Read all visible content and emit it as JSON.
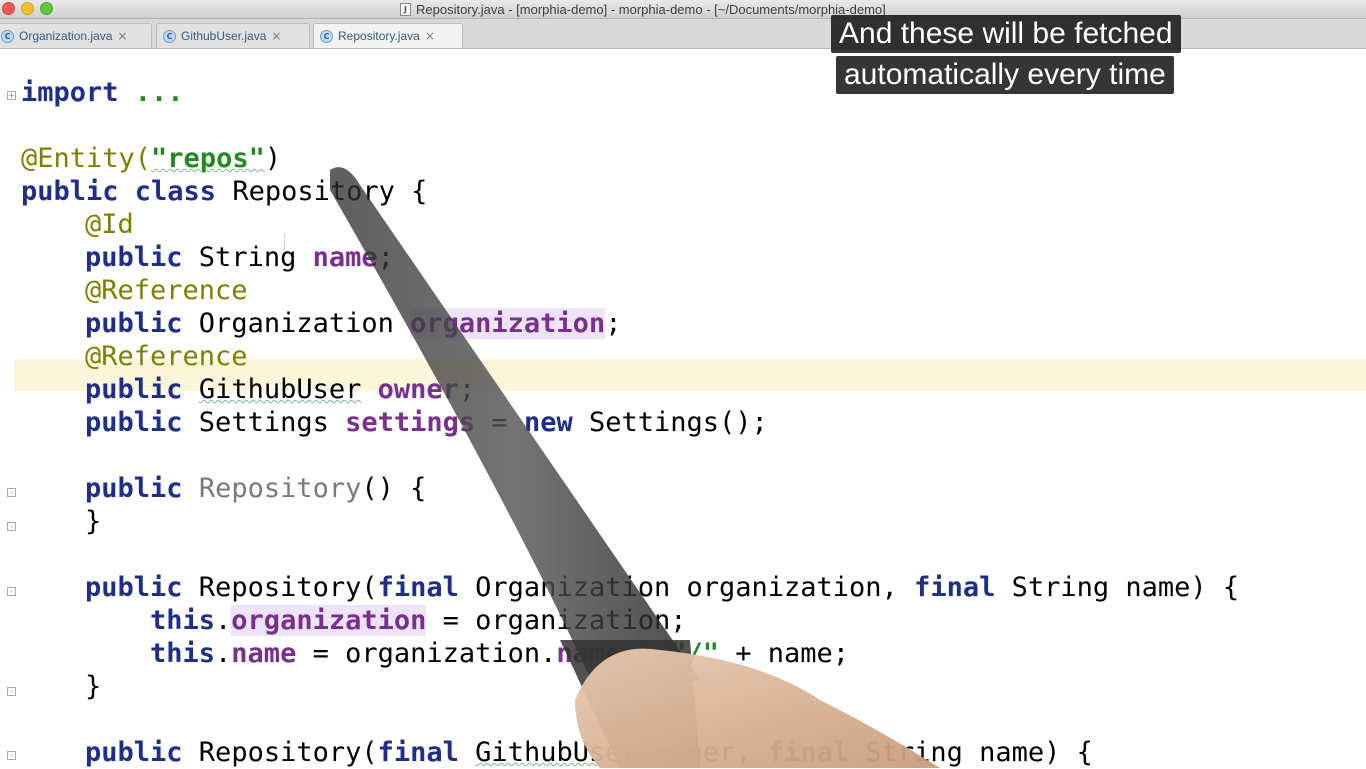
{
  "window": {
    "title": "Repository.java - [morphia-demo] - morphia-demo - [~/Documents/morphia-demo]",
    "file_icon_glyph": "J"
  },
  "tabs": [
    {
      "label": "Organization.java",
      "icon": "java-class-icon",
      "icon_glyph": "C",
      "close": "×"
    },
    {
      "label": "GithubUser.java",
      "icon": "java-class-icon",
      "icon_glyph": "C",
      "close": "×"
    },
    {
      "label": "Repository.java",
      "icon": "java-class-icon",
      "icon_glyph": "C",
      "close": "×",
      "active": true
    }
  ],
  "code": {
    "l_import": [
      "import",
      " ..."
    ],
    "l_entity": [
      "@Entity(",
      "\"repos\"",
      ")"
    ],
    "l_class": [
      "public class",
      " Repository {"
    ],
    "l_id": [
      "@Id"
    ],
    "l_name": [
      "public",
      " String ",
      "name",
      ";"
    ],
    "l_ref1": [
      "@Reference"
    ],
    "l_org": [
      "public",
      " Organization ",
      "organization",
      ";"
    ],
    "l_ref2": [
      "@Reference"
    ],
    "l_owner": [
      "public",
      " ",
      "GithubUser",
      " ",
      "owner",
      ";"
    ],
    "l_settings": [
      "public",
      " Settings ",
      "settings",
      " = ",
      "new",
      " Settings();"
    ],
    "l_ctor0": [
      "public",
      " ",
      "Repository",
      "() {"
    ],
    "l_ctor0_end": [
      "}"
    ],
    "l_ctor1": [
      "public",
      " Repository(",
      "final",
      " Organization organization, ",
      "final",
      " String name) {"
    ],
    "l_this_org": [
      "this",
      ".",
      "organization",
      " = organization;"
    ],
    "l_this_name": [
      "this",
      ".",
      "name",
      " = organization.",
      "name",
      " + ",
      "\"/\"",
      " + name;"
    ],
    "l_ctor1_end": [
      "}"
    ],
    "l_ctor2": [
      "public",
      " Repository(",
      "final",
      " ",
      "GithubUser",
      " owner, ",
      "final",
      " String name) {"
    ]
  },
  "captions": [
    "And these will be fetched",
    "automatically every time"
  ],
  "colors": {
    "keyword": "#1f2e8a",
    "annotation": "#808000",
    "string": "#218a21",
    "field": "#7a2f90",
    "current_line": "#fbf5d9"
  }
}
